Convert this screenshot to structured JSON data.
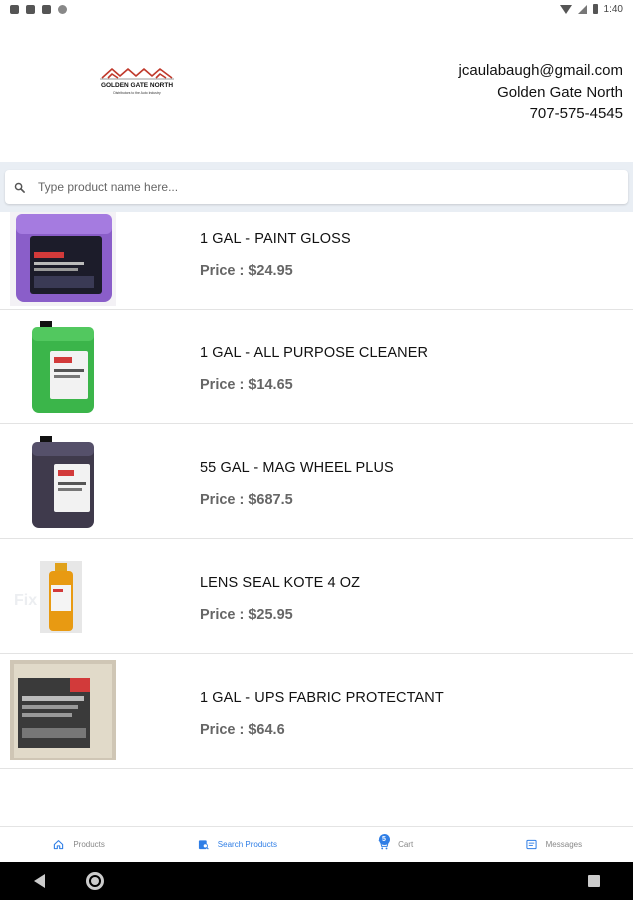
{
  "status_bar": {
    "time": "1:40"
  },
  "header": {
    "logo_text": "GOLDEN GATE NORTH",
    "logo_subtext": "Distributors to the Auto Industry",
    "email": "jcaulabaugh@gmail.com",
    "company": "Golden Gate North",
    "phone": "707-575-4545"
  },
  "search": {
    "placeholder": "Type product name here..."
  },
  "products": [
    {
      "name": "1 GAL - PAINT GLOSS",
      "price_label": "Price : ",
      "price": "$24.95",
      "image": "purple-gallon-jug"
    },
    {
      "name": "1 GAL - ALL PURPOSE CLEANER",
      "price_label": "Price : ",
      "price": "$14.65",
      "image": "green-gallon-jug"
    },
    {
      "name": "55 GAL - MAG WHEEL PLUS",
      "price_label": "Price : ",
      "price": "$687.5",
      "image": "dark-gallon-jug"
    },
    {
      "name": "LENS SEAL KOTE 4 OZ",
      "price_label": "Price : ",
      "price": "$25.95",
      "image": "small-bottle"
    },
    {
      "name": "1 GAL - UPS FABRIC PROTECTANT",
      "price_label": "Price : ",
      "price": "$64.6",
      "image": "box-container"
    }
  ],
  "bottom_nav": {
    "items": [
      {
        "label": "Products",
        "icon": "home-icon"
      },
      {
        "label": "Search Products",
        "icon": "search-products-icon"
      },
      {
        "label": "Cart",
        "icon": "cart-icon"
      },
      {
        "label": "Messages",
        "icon": "messages-icon"
      }
    ],
    "active_index": 1,
    "cart_count": "5"
  },
  "colors": {
    "accent": "#2f7ee6",
    "search_band": "#e9eef4",
    "logo_red": "#c0392b"
  }
}
